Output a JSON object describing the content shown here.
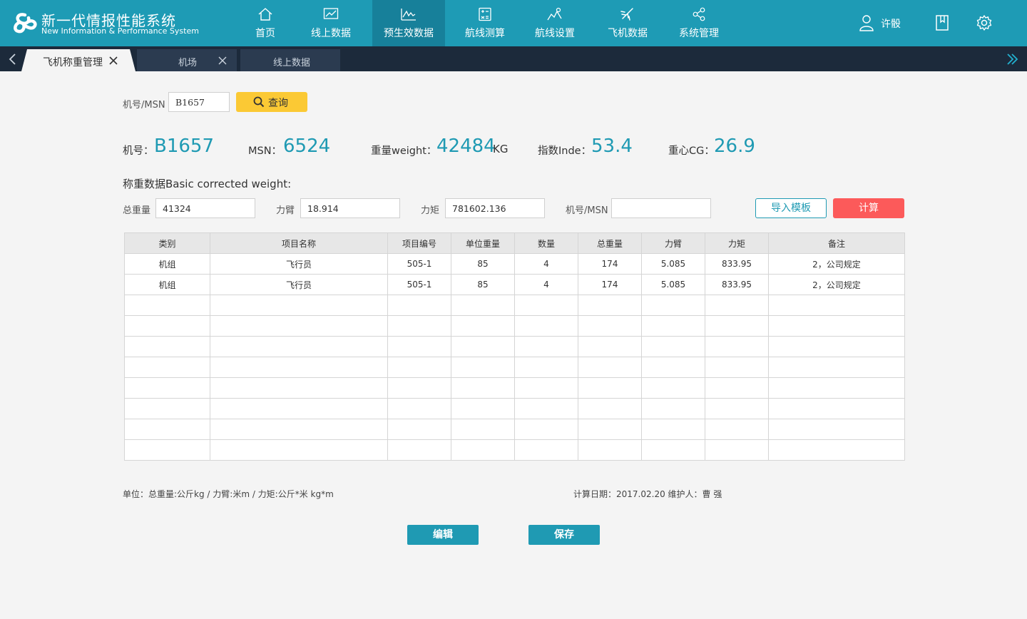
{
  "brand": {
    "title": "新一代情报性能系统",
    "subtitle": "New Information & Performance System"
  },
  "nav": [
    {
      "label": "首页",
      "icon": "home-icon"
    },
    {
      "label": "线上数据",
      "icon": "trend-chart-icon"
    },
    {
      "label": "预生效数据",
      "icon": "line-chart-icon",
      "active": true
    },
    {
      "label": "航线测算",
      "icon": "calculator-icon"
    },
    {
      "label": "航线设置",
      "icon": "route-icon"
    },
    {
      "label": "飞机数据",
      "icon": "airplane-icon"
    },
    {
      "label": "系统管理",
      "icon": "share-icon"
    }
  ],
  "user": {
    "name": "许骰",
    "icon": "user-icon"
  },
  "header_icons": [
    "bookmark-icon",
    "gear-icon"
  ],
  "tabs": [
    {
      "label": "飞机称重管理",
      "active": true
    },
    {
      "label": "机场",
      "active": false
    },
    {
      "label": "线上数据",
      "active": false
    }
  ],
  "search": {
    "label": "机号/MSN",
    "value": "B1657",
    "button": "查询"
  },
  "summary": {
    "reg_label": "机号：",
    "reg_value": "B1657",
    "msn_label": "MSN：",
    "msn_value": "6524",
    "weight_label": "重量weight：",
    "weight_value": "42484",
    "weight_unit": "KG",
    "index_label": "指数Inde：",
    "index_value": "53.4",
    "cg_label": "重心CG：",
    "cg_value": "26.9"
  },
  "section_title": "称重数据Basic corrected weight:",
  "form": {
    "total_weight_label": "总重量",
    "total_weight_value": "41324",
    "arm_label": "力臂",
    "arm_value": "18.914",
    "moment_label": "力矩",
    "moment_value": "781602.136",
    "msn_label": "机号/MSN",
    "msn_value": "",
    "import_button": "导入模板",
    "calc_button": "计算"
  },
  "table": {
    "columns": [
      "类别",
      "项目名称",
      "项目编号",
      "单位重量",
      "数量",
      "总重量",
      "力臂",
      "力矩",
      "备注"
    ],
    "rows": [
      [
        "机组",
        "飞行员",
        "505-1",
        "85",
        "4",
        "174",
        "5.085",
        "833.95",
        "2，公司规定"
      ],
      [
        "机组",
        "飞行员",
        "505-1",
        "85",
        "4",
        "174",
        "5.085",
        "833.95",
        "2，公司规定"
      ],
      [
        "",
        "",
        "",
        "",
        "",
        "",
        "",
        "",
        ""
      ],
      [
        "",
        "",
        "",
        "",
        "",
        "",
        "",
        "",
        ""
      ],
      [
        "",
        "",
        "",
        "",
        "",
        "",
        "",
        "",
        ""
      ],
      [
        "",
        "",
        "",
        "",
        "",
        "",
        "",
        "",
        ""
      ],
      [
        "",
        "",
        "",
        "",
        "",
        "",
        "",
        "",
        ""
      ],
      [
        "",
        "",
        "",
        "",
        "",
        "",
        "",
        "",
        ""
      ],
      [
        "",
        "",
        "",
        "",
        "",
        "",
        "",
        "",
        ""
      ],
      [
        "",
        "",
        "",
        "",
        "",
        "",
        "",
        "",
        ""
      ]
    ]
  },
  "footer": {
    "units": "单位：总重量:公斤kg  /  力臂:米m  /  力矩:公斤*米 kg*m",
    "calc_date": "计算日期：2017.02.20   维护人：曹 强"
  },
  "actions": {
    "edit": "编辑",
    "save": "保存"
  },
  "colors": {
    "header": "#1e9bb5",
    "header_active": "#17809a",
    "tabbar": "#1c2a3b",
    "accent": "#1f9ab3",
    "query_button": "#fbc934",
    "calc_button": "#fc5a5a"
  }
}
